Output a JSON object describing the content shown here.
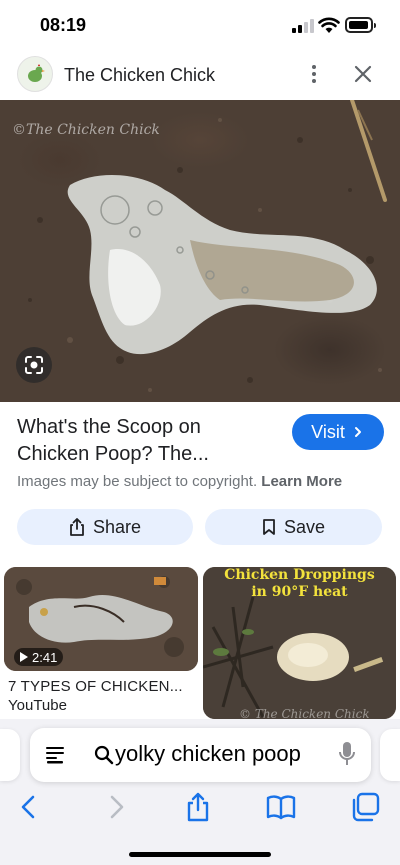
{
  "status_bar": {
    "time": "08:19"
  },
  "header": {
    "site_name": "The Chicken Chick"
  },
  "hero": {
    "watermark": "©The Chicken Chick"
  },
  "result": {
    "title": "What's the Scoop on Chicken Poop? The...",
    "visit_label": "Visit",
    "copyright_text": "Images may be subject to copyright.",
    "learn_more": "Learn More"
  },
  "actions": {
    "share_label": "Share",
    "save_label": "Save"
  },
  "related": [
    {
      "duration": "2:41",
      "title": "7 TYPES OF CHICKEN...",
      "source": "YouTube"
    },
    {
      "caption_line1": "Chicken Droppings",
      "caption_line2": "in 90°F heat",
      "watermark": "© The Chicken Chick"
    }
  ],
  "browser": {
    "address": "yolky chicken poop"
  },
  "colors": {
    "accent": "#1a73e8",
    "chip_bg": "#e8f0fe",
    "hero_bg": "#4d3f35"
  },
  "icons": [
    "chicken-logo-icon",
    "more-vert-icon",
    "close-icon",
    "lens-icon",
    "chevron-right-icon",
    "share-icon",
    "bookmark-icon",
    "play-icon",
    "reader-icon",
    "search-icon",
    "mic-icon",
    "back-icon",
    "forward-icon",
    "share-icon",
    "bookmarks-icon",
    "tabs-icon"
  ]
}
